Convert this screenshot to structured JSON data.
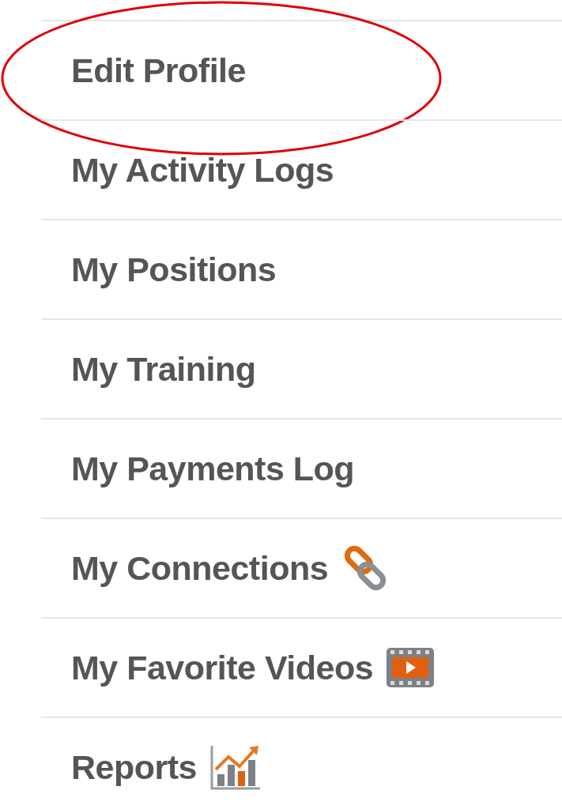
{
  "menu": {
    "items": [
      {
        "label": "Edit Profile",
        "kind": "plain",
        "highlighted": true
      },
      {
        "label": "My Activity Logs",
        "kind": "plain",
        "highlighted": false
      },
      {
        "label": "My Positions",
        "kind": "plain",
        "highlighted": false
      },
      {
        "label": "My Training",
        "kind": "plain",
        "highlighted": false
      },
      {
        "label": "My Payments Log",
        "kind": "plain",
        "highlighted": false
      },
      {
        "label": "My Connections",
        "kind": "link",
        "highlighted": false
      },
      {
        "label": "My Favorite Videos",
        "kind": "video",
        "highlighted": false
      },
      {
        "label": "Reports",
        "kind": "chart",
        "highlighted": false
      }
    ]
  }
}
